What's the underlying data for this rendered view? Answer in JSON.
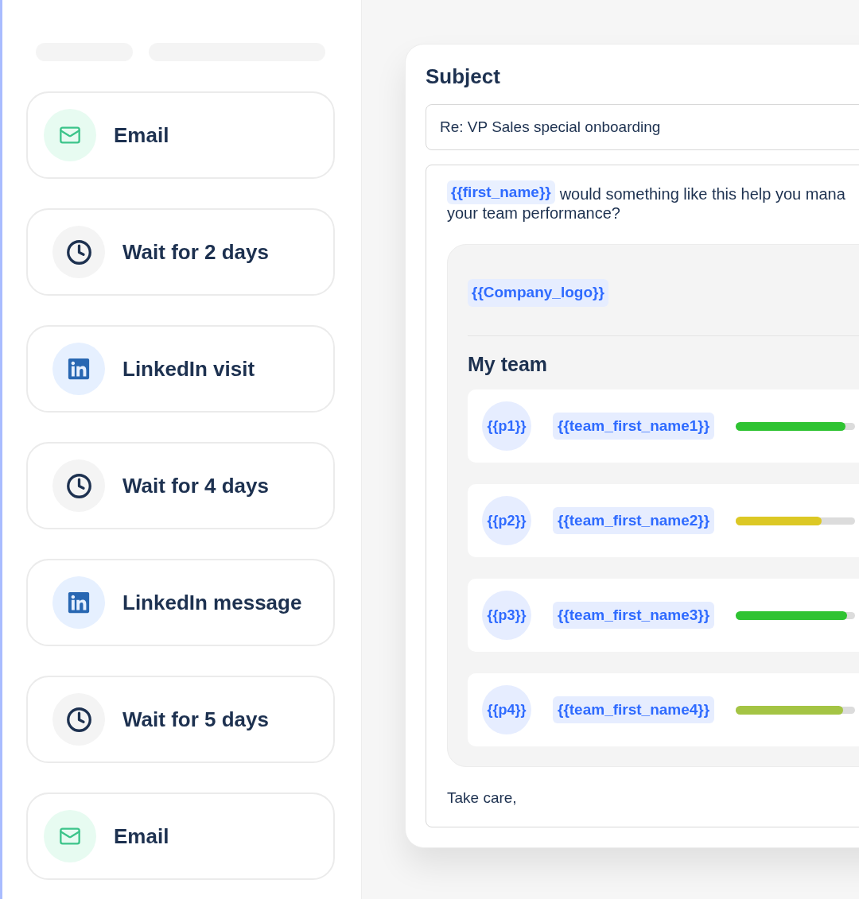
{
  "sidebar": {
    "steps": [
      {
        "kind": "email",
        "label": "Email"
      },
      {
        "kind": "wait",
        "label": "Wait for 2 days"
      },
      {
        "kind": "linkedin",
        "label": "LinkedIn visit"
      },
      {
        "kind": "wait",
        "label": "Wait for 4 days"
      },
      {
        "kind": "linkedin",
        "label": "LinkedIn message"
      },
      {
        "kind": "wait",
        "label": "Wait for 5 days"
      },
      {
        "kind": "email",
        "label": "Email"
      }
    ]
  },
  "editor": {
    "subject_label": "Subject",
    "subject_value": "Re: VP Sales special onboarding",
    "body": {
      "greeting_tag": "{{first_name}}",
      "intro_line_1": "would something like this help you mana",
      "intro_line_2": "your team performance?",
      "template": {
        "logo_tag": "{{Company_logo}}",
        "heading": "My team",
        "members": [
          {
            "avatar": "{{p1}}",
            "name_tag": "{{team_first_name1}}",
            "level": 0.92,
            "color": "#2fc332"
          },
          {
            "avatar": "{{p2}}",
            "name_tag": "{{team_first_name2}}",
            "level": 0.72,
            "color": "#dcc825"
          },
          {
            "avatar": "{{p3}}",
            "name_tag": "{{team_first_name3}}",
            "level": 0.93,
            "color": "#2fc332"
          },
          {
            "avatar": "{{p4}}",
            "name_tag": "{{team_first_name4}}",
            "level": 0.9,
            "color": "#a4c444"
          }
        ]
      },
      "closing": "Take care,"
    }
  }
}
